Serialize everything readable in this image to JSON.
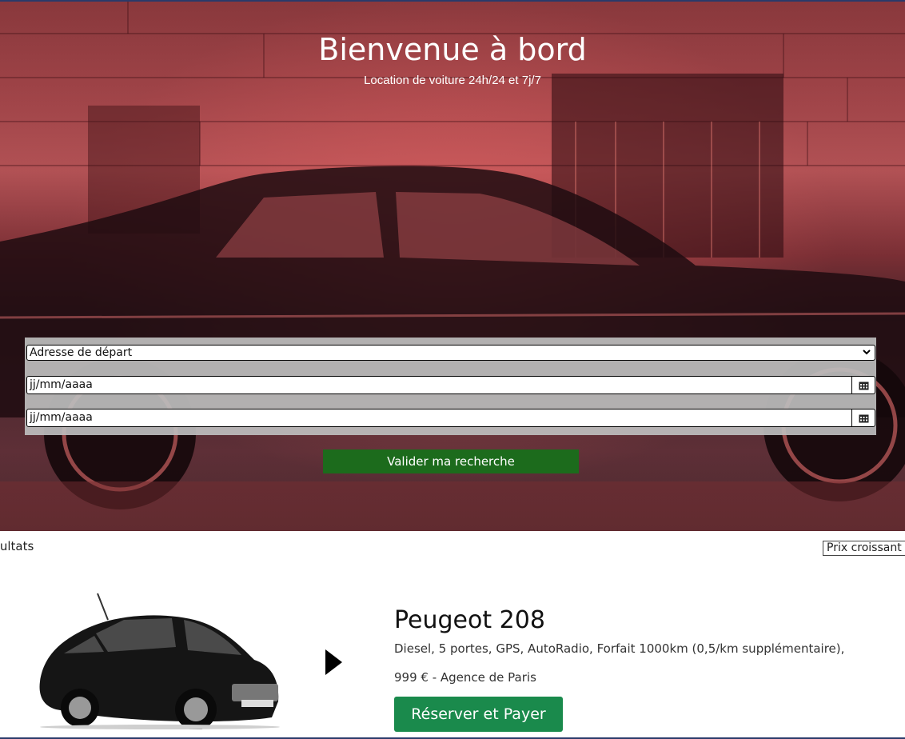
{
  "hero": {
    "title": "Bienvenue à bord",
    "subtitle": "Location de voiture 24h/24 et 7j/7"
  },
  "search": {
    "departure_select_value": "Adresse de départ",
    "start_date_placeholder": "jj/mm/aaaa",
    "end_date_placeholder": "jj/mm/aaaa",
    "submit_label": "Valider ma recherche"
  },
  "results": {
    "label": "sultats",
    "sort_value": "Prix croissant"
  },
  "car": {
    "name": "Peugeot 208",
    "features": "Diesel, 5 portes, GPS, AutoRadio, Forfait 1000km (0,5/km supplémentaire),",
    "price_agency": "999 € - Agence de Paris",
    "book_label": "Réserver et Payer"
  },
  "colors": {
    "submit_green": "#1c6b1c",
    "book_green": "#1a8a4c",
    "hero_tint": "#b85659"
  },
  "icons": {
    "select_chevron": "chevron-down-icon",
    "date_picker": "calendar-icon",
    "card_arrow": "play-arrow-icon"
  }
}
